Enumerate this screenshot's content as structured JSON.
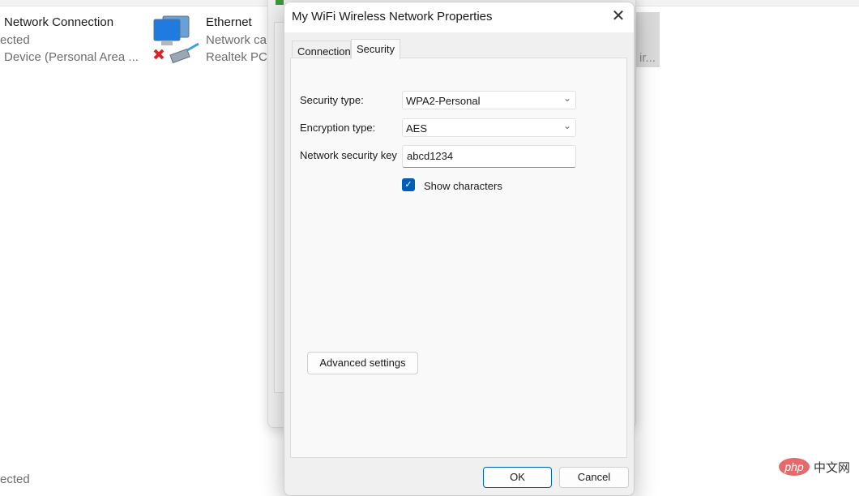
{
  "background_window": {
    "items": [
      {
        "title": "Network Connection",
        "status": "ected",
        "device": "Device (Personal Area ..."
      },
      {
        "title": "Ethernet",
        "status": "Network ca",
        "device": "Realtek PCIe"
      }
    ],
    "bottom_status": "ected",
    "clipped_text": "ir..."
  },
  "dialog": {
    "title": "My WiFi Wireless Network Properties",
    "tabs": [
      {
        "label": "Connection",
        "selected": false
      },
      {
        "label": "Security",
        "selected": true
      }
    ],
    "security_type_label": "Security type:",
    "security_type_value": "WPA2-Personal",
    "encryption_type_label": "Encryption type:",
    "encryption_type_value": "AES",
    "key_label": "Network security key",
    "key_value": "abcd1234",
    "show_characters_label": "Show characters",
    "show_characters_checked": true,
    "advanced_button": "Advanced settings",
    "ok_button": "OK",
    "cancel_button": "Cancel"
  },
  "watermark": {
    "text": "php 中文网"
  },
  "colors": {
    "accent": "#005fb8",
    "dialog_bg": "#f0f0f0"
  }
}
